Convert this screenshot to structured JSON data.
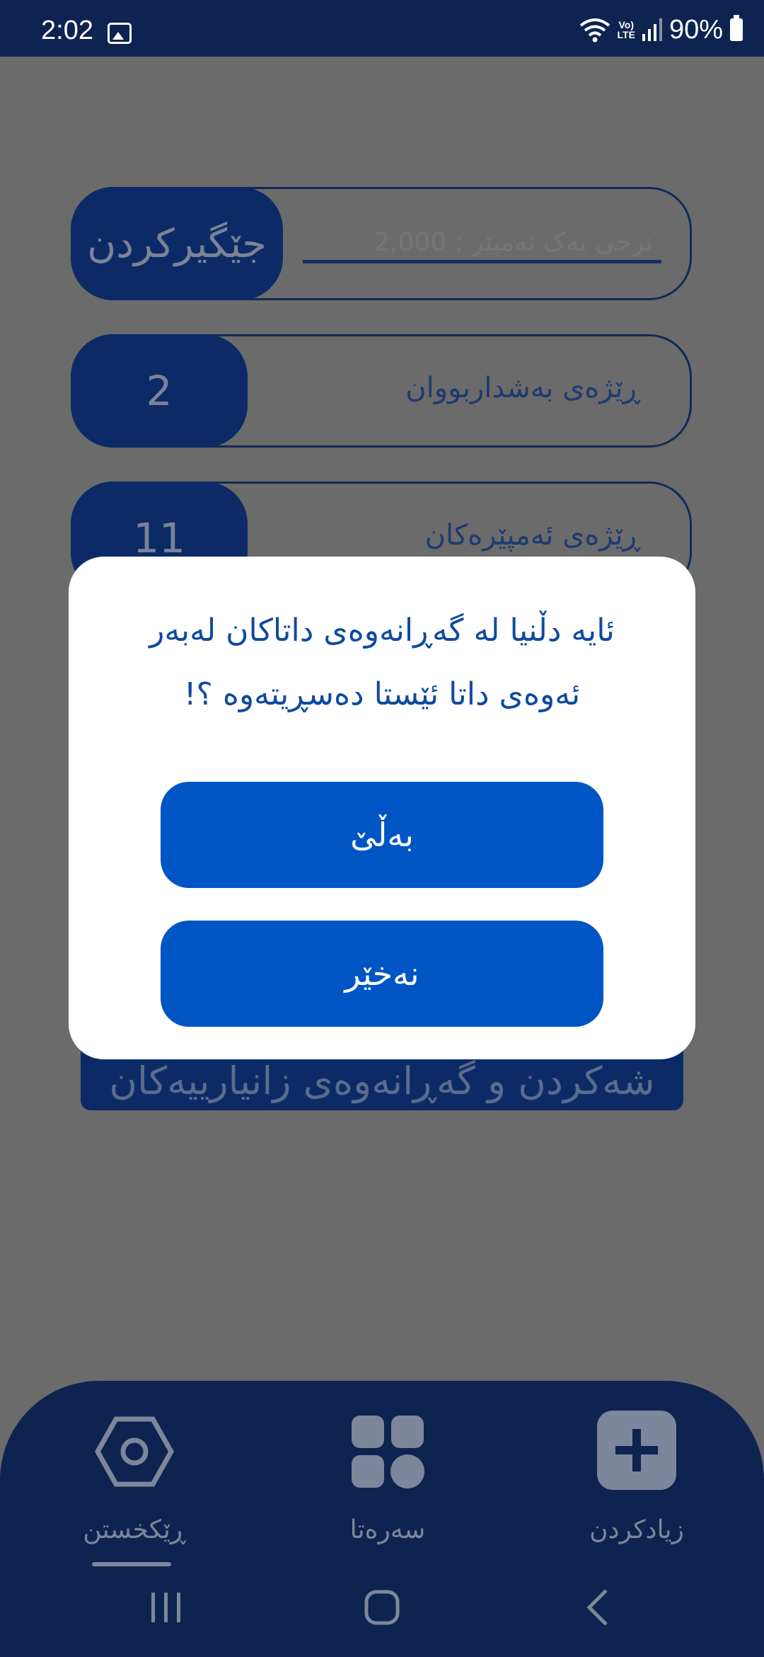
{
  "status_bar": {
    "time": "2:02",
    "battery": "90%",
    "network": "LTE"
  },
  "form": {
    "price_placeholder": "نرخی یەک ئەمپێر : 2,000",
    "save_button": "جێگیرکردن",
    "participants_label": "ڕێژەی بەشداربووان",
    "participants_count": "2",
    "amperes_label": "ڕێژەی ئەمپێرەکان",
    "amperes_count": "11",
    "backup_button": "شەکردن و گەڕانەوەی زانیارییەکان"
  },
  "dialog": {
    "line1": "ئایە دڵنیا لە گەڕانەوەی داتاکان لەبەر",
    "line2": "ئەوەی داتا ئێستا دەسڕیتەوە ؟!",
    "yes": "بەڵێ",
    "no": "نەخێر"
  },
  "bottom_nav": {
    "settings": "ڕێکخستن",
    "home": "سەرەتا",
    "add": "زیادکردن"
  },
  "colors": {
    "primary": "#0055c4",
    "navy": "#0f2350",
    "dialog_text": "#0f4aa0"
  }
}
